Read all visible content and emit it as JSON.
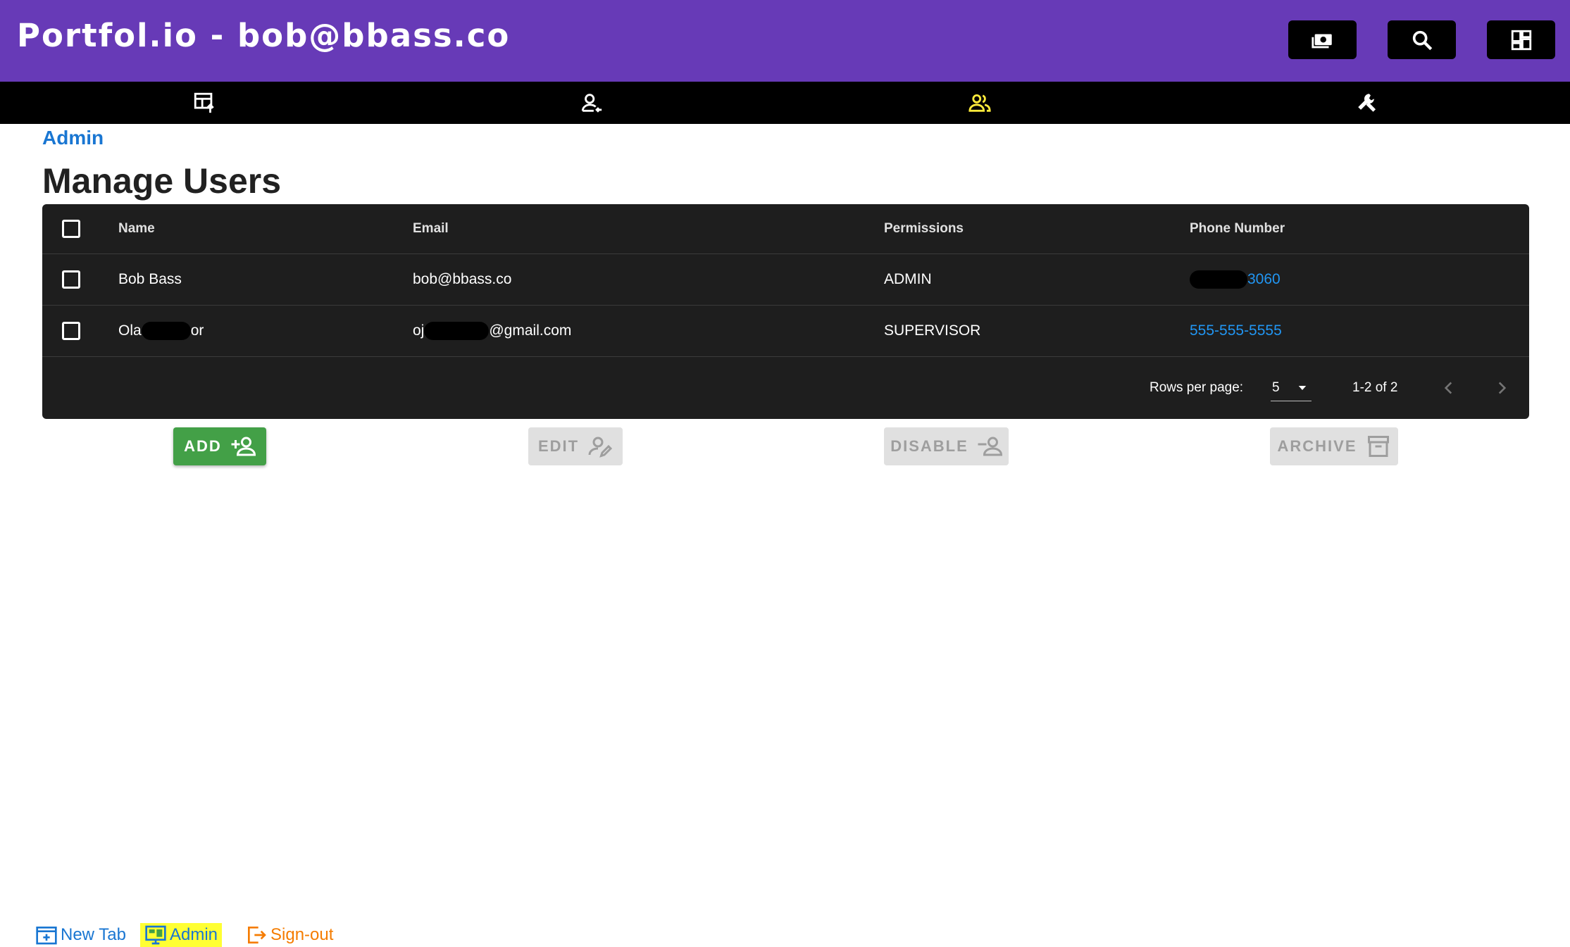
{
  "header": {
    "title": "Portfol.io - bob@bbass.co",
    "buttons": [
      {
        "icon": "cash-icon"
      },
      {
        "icon": "search-icon"
      },
      {
        "icon": "dashboard-icon"
      }
    ]
  },
  "nav": {
    "items": [
      {
        "icon": "table-upload-icon"
      },
      {
        "icon": "person-add-icon"
      },
      {
        "icon": "people-icon",
        "active": true
      },
      {
        "icon": "wrench-icon"
      }
    ],
    "active_color": "#ffeb3b"
  },
  "breadcrumb": "Admin",
  "page_title": "Manage Users",
  "table": {
    "headers": {
      "name": "Name",
      "email": "Email",
      "permissions": "Permissions",
      "phone": "Phone Number"
    },
    "rows": [
      {
        "name": "Bob Bass",
        "email": "bob@bbass.co",
        "permissions": "ADMIN",
        "phone_prefix": "",
        "phone": "3060"
      },
      {
        "name_start": "Ola",
        "name_end": "or",
        "email_start": "oj",
        "email_end": "@gmail.com",
        "permissions": "SUPERVISOR",
        "phone": "555-555-5555"
      }
    ],
    "pagination": {
      "rows_per_page_label": "Rows per page:",
      "rows_per_page": "5",
      "range": "1-2 of 2"
    }
  },
  "actions": {
    "add": "ADD",
    "edit": "EDIT",
    "disable": "DISABLE",
    "archive": "ARCHIVE"
  },
  "footer": {
    "new_tab": "New Tab",
    "admin": "Admin",
    "sign_out": "Sign-out"
  },
  "colors": {
    "header_bg": "#673ab7",
    "link_blue": "#1976d2",
    "add_green": "#43a047",
    "signout_orange": "#f57c00",
    "highlight_yellow": "#ffff33"
  }
}
